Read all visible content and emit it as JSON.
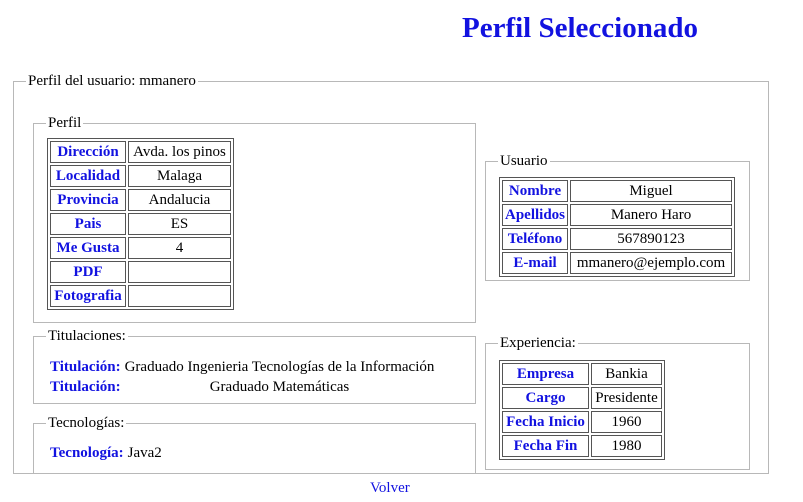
{
  "page_title": "Perfil Seleccionado",
  "outer_legend": "Perfil del usuario: mmanero",
  "perfil": {
    "legend": "Perfil",
    "rows": [
      {
        "label": "Dirección",
        "value": "Avda. los pinos"
      },
      {
        "label": "Localidad",
        "value": "Malaga"
      },
      {
        "label": "Provincia",
        "value": "Andalucia"
      },
      {
        "label": "Pais",
        "value": "ES"
      },
      {
        "label": "Me Gusta",
        "value": "4"
      },
      {
        "label": "PDF",
        "value": ""
      },
      {
        "label": "Fotografia",
        "value": ""
      }
    ]
  },
  "usuario": {
    "legend": "Usuario",
    "rows": [
      {
        "label": "Nombre",
        "value": "Miguel"
      },
      {
        "label": "Apellidos",
        "value": "Manero Haro"
      },
      {
        "label": "Teléfono",
        "value": "567890123"
      },
      {
        "label": "E-mail",
        "value": "mmanero@ejemplo.com"
      }
    ]
  },
  "titulaciones": {
    "legend": "Titulaciones:",
    "rows": [
      {
        "label": "Titulación:",
        "value": "Graduado Ingenieria Tecnologías de la Información"
      },
      {
        "label": "Titulación:",
        "value": "Graduado Matemáticas"
      }
    ]
  },
  "tecnologias": {
    "legend": "Tecnologías:",
    "rows": [
      {
        "label": "Tecnología:",
        "value": "Java2"
      }
    ]
  },
  "experiencia": {
    "legend": "Experiencia:",
    "rows": [
      {
        "label": "Empresa",
        "value": "Bankia"
      },
      {
        "label": "Cargo",
        "value": "Presidente"
      },
      {
        "label": "Fecha Inicio",
        "value": "1960"
      },
      {
        "label": "Fecha Fin",
        "value": "1980"
      }
    ]
  },
  "volver_label": "Volver"
}
